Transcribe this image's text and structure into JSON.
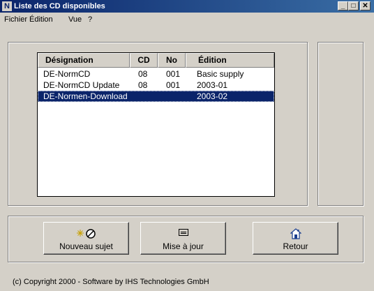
{
  "window": {
    "title": "Liste des CD disponibles",
    "icon_letter": "N",
    "controls": {
      "minimize": "_",
      "maximize": "□",
      "close": "✕"
    }
  },
  "menu": [
    {
      "label": "Fichier"
    },
    {
      "label": "Édition"
    },
    {
      "label": "Vue"
    },
    {
      "label": "?"
    }
  ],
  "table": {
    "columns": [
      "Désignation",
      "CD",
      "No",
      "Édition"
    ],
    "rows": [
      {
        "designation": "DE-NormCD",
        "cd": "08",
        "no": "001",
        "edition": "Basic supply",
        "selected": false
      },
      {
        "designation": "DE-NormCD Update",
        "cd": "08",
        "no": "001",
        "edition": "2003-01",
        "selected": false
      },
      {
        "designation": "DE-Normen-Download",
        "cd": "",
        "no": "",
        "edition": "2003-02",
        "selected": true
      }
    ]
  },
  "buttons": {
    "new_subject": {
      "label": "Nouveau sujet",
      "icon": "new-subject-icon"
    },
    "update": {
      "label": "Mise à jour",
      "icon": "cd-drive-icon"
    },
    "back": {
      "label": "Retour",
      "icon": "home-icon"
    }
  },
  "status": {
    "text": "(c) Copyright 2000  -  Software by IHS Technologies GmbH"
  },
  "colors": {
    "titlebar": "#0a246a",
    "selection": "#0a246a",
    "face": "#d4d0c8"
  }
}
